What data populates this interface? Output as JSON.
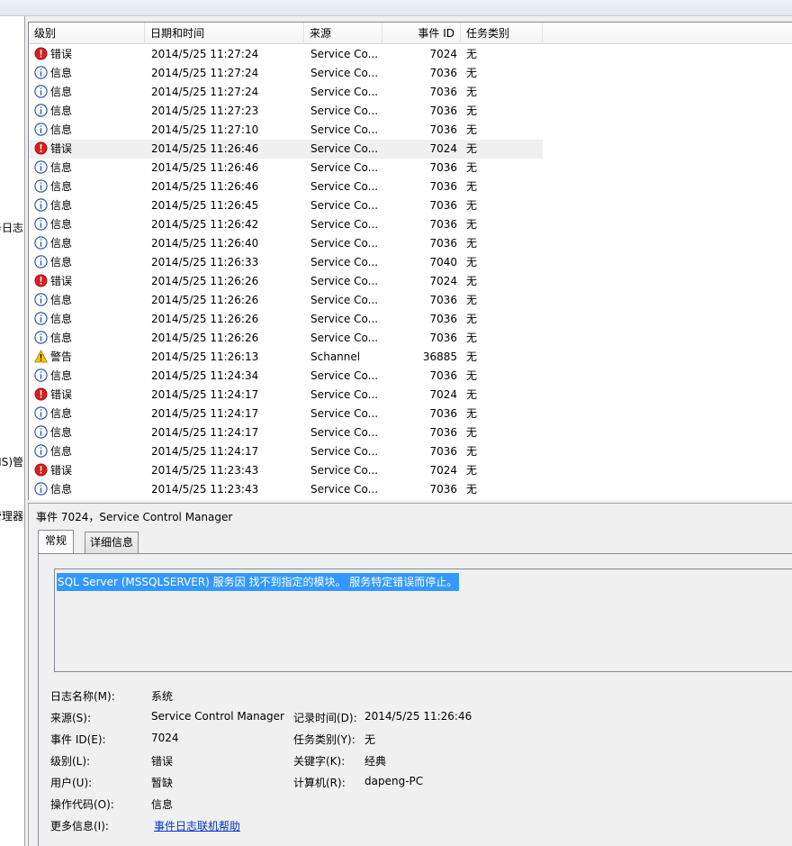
{
  "left_pane": {
    "fragments": [
      "务日志",
      "(IIS)管",
      "管理器"
    ]
  },
  "columns": {
    "level": "级别",
    "datetime": "日期和时间",
    "source": "来源",
    "event_id": "事件 ID",
    "task_category": "任务类别"
  },
  "events": [
    {
      "level": "error",
      "level_text": "错误",
      "datetime": "2014/5/25 11:27:24",
      "source": "Service Co...",
      "event_id": "7024",
      "task": "无"
    },
    {
      "level": "info",
      "level_text": "信息",
      "datetime": "2014/5/25 11:27:24",
      "source": "Service Co...",
      "event_id": "7036",
      "task": "无"
    },
    {
      "level": "info",
      "level_text": "信息",
      "datetime": "2014/5/25 11:27:24",
      "source": "Service Co...",
      "event_id": "7036",
      "task": "无"
    },
    {
      "level": "info",
      "level_text": "信息",
      "datetime": "2014/5/25 11:27:23",
      "source": "Service Co...",
      "event_id": "7036",
      "task": "无"
    },
    {
      "level": "info",
      "level_text": "信息",
      "datetime": "2014/5/25 11:27:10",
      "source": "Service Co...",
      "event_id": "7036",
      "task": "无"
    },
    {
      "level": "error",
      "level_text": "错误",
      "datetime": "2014/5/25 11:26:46",
      "source": "Service Co...",
      "event_id": "7024",
      "task": "无",
      "selected": true
    },
    {
      "level": "info",
      "level_text": "信息",
      "datetime": "2014/5/25 11:26:46",
      "source": "Service Co...",
      "event_id": "7036",
      "task": "无"
    },
    {
      "level": "info",
      "level_text": "信息",
      "datetime": "2014/5/25 11:26:46",
      "source": "Service Co...",
      "event_id": "7036",
      "task": "无"
    },
    {
      "level": "info",
      "level_text": "信息",
      "datetime": "2014/5/25 11:26:45",
      "source": "Service Co...",
      "event_id": "7036",
      "task": "无"
    },
    {
      "level": "info",
      "level_text": "信息",
      "datetime": "2014/5/25 11:26:42",
      "source": "Service Co...",
      "event_id": "7036",
      "task": "无"
    },
    {
      "level": "info",
      "level_text": "信息",
      "datetime": "2014/5/25 11:26:40",
      "source": "Service Co...",
      "event_id": "7036",
      "task": "无"
    },
    {
      "level": "info",
      "level_text": "信息",
      "datetime": "2014/5/25 11:26:33",
      "source": "Service Co...",
      "event_id": "7040",
      "task": "无"
    },
    {
      "level": "error",
      "level_text": "错误",
      "datetime": "2014/5/25 11:26:26",
      "source": "Service Co...",
      "event_id": "7024",
      "task": "无"
    },
    {
      "level": "info",
      "level_text": "信息",
      "datetime": "2014/5/25 11:26:26",
      "source": "Service Co...",
      "event_id": "7036",
      "task": "无"
    },
    {
      "level": "info",
      "level_text": "信息",
      "datetime": "2014/5/25 11:26:26",
      "source": "Service Co...",
      "event_id": "7036",
      "task": "无"
    },
    {
      "level": "info",
      "level_text": "信息",
      "datetime": "2014/5/25 11:26:26",
      "source": "Service Co...",
      "event_id": "7036",
      "task": "无"
    },
    {
      "level": "warning",
      "level_text": "警告",
      "datetime": "2014/5/25 11:26:13",
      "source": "Schannel",
      "event_id": "36885",
      "task": "无"
    },
    {
      "level": "info",
      "level_text": "信息",
      "datetime": "2014/5/25 11:24:34",
      "source": "Service Co...",
      "event_id": "7036",
      "task": "无"
    },
    {
      "level": "error",
      "level_text": "错误",
      "datetime": "2014/5/25 11:24:17",
      "source": "Service Co...",
      "event_id": "7024",
      "task": "无"
    },
    {
      "level": "info",
      "level_text": "信息",
      "datetime": "2014/5/25 11:24:17",
      "source": "Service Co...",
      "event_id": "7036",
      "task": "无"
    },
    {
      "level": "info",
      "level_text": "信息",
      "datetime": "2014/5/25 11:24:17",
      "source": "Service Co...",
      "event_id": "7036",
      "task": "无"
    },
    {
      "level": "info",
      "level_text": "信息",
      "datetime": "2014/5/25 11:24:17",
      "source": "Service Co...",
      "event_id": "7036",
      "task": "无"
    },
    {
      "level": "error",
      "level_text": "错误",
      "datetime": "2014/5/25 11:23:43",
      "source": "Service Co...",
      "event_id": "7024",
      "task": "无"
    },
    {
      "level": "info",
      "level_text": "信息",
      "datetime": "2014/5/25 11:23:43",
      "source": "Service Co...",
      "event_id": "7036",
      "task": "无"
    }
  ],
  "icon_names": {
    "error": "error-icon",
    "info": "info-icon",
    "warning": "warning-icon"
  },
  "colors": {
    "error": "#d81e1e",
    "info": "#2f5c9e",
    "warning": "#f5c400",
    "selection": "#3399ff"
  },
  "detail": {
    "title": "事件 7024，Service Control Manager",
    "tabs": [
      "常规",
      "详细信息"
    ],
    "message": "SQL Server (MSSQLSERVER) 服务因 找不到指定的模块。 服务特定错误而停止。",
    "labels": {
      "log_name": "日志名称(M):",
      "source": "来源(S):",
      "event_id": "事件 ID(E):",
      "level": "级别(L):",
      "user": "用户(U):",
      "opcode": "操作代码(O):",
      "more_info": "更多信息(I):",
      "logged": "记录时间(D):",
      "task_category": "任务类别(Y):",
      "keywords": "关键字(K):",
      "computer": "计算机(R):"
    },
    "values": {
      "log_name": "系统",
      "source": "Service Control Manager",
      "event_id": "7024",
      "level": "错误",
      "user": "暂缺",
      "opcode": "信息",
      "more_info_link": "事件日志联机帮助",
      "logged": "2014/5/25 11:26:46",
      "task_category": "无",
      "keywords": "经典",
      "computer": "dapeng-PC"
    }
  }
}
